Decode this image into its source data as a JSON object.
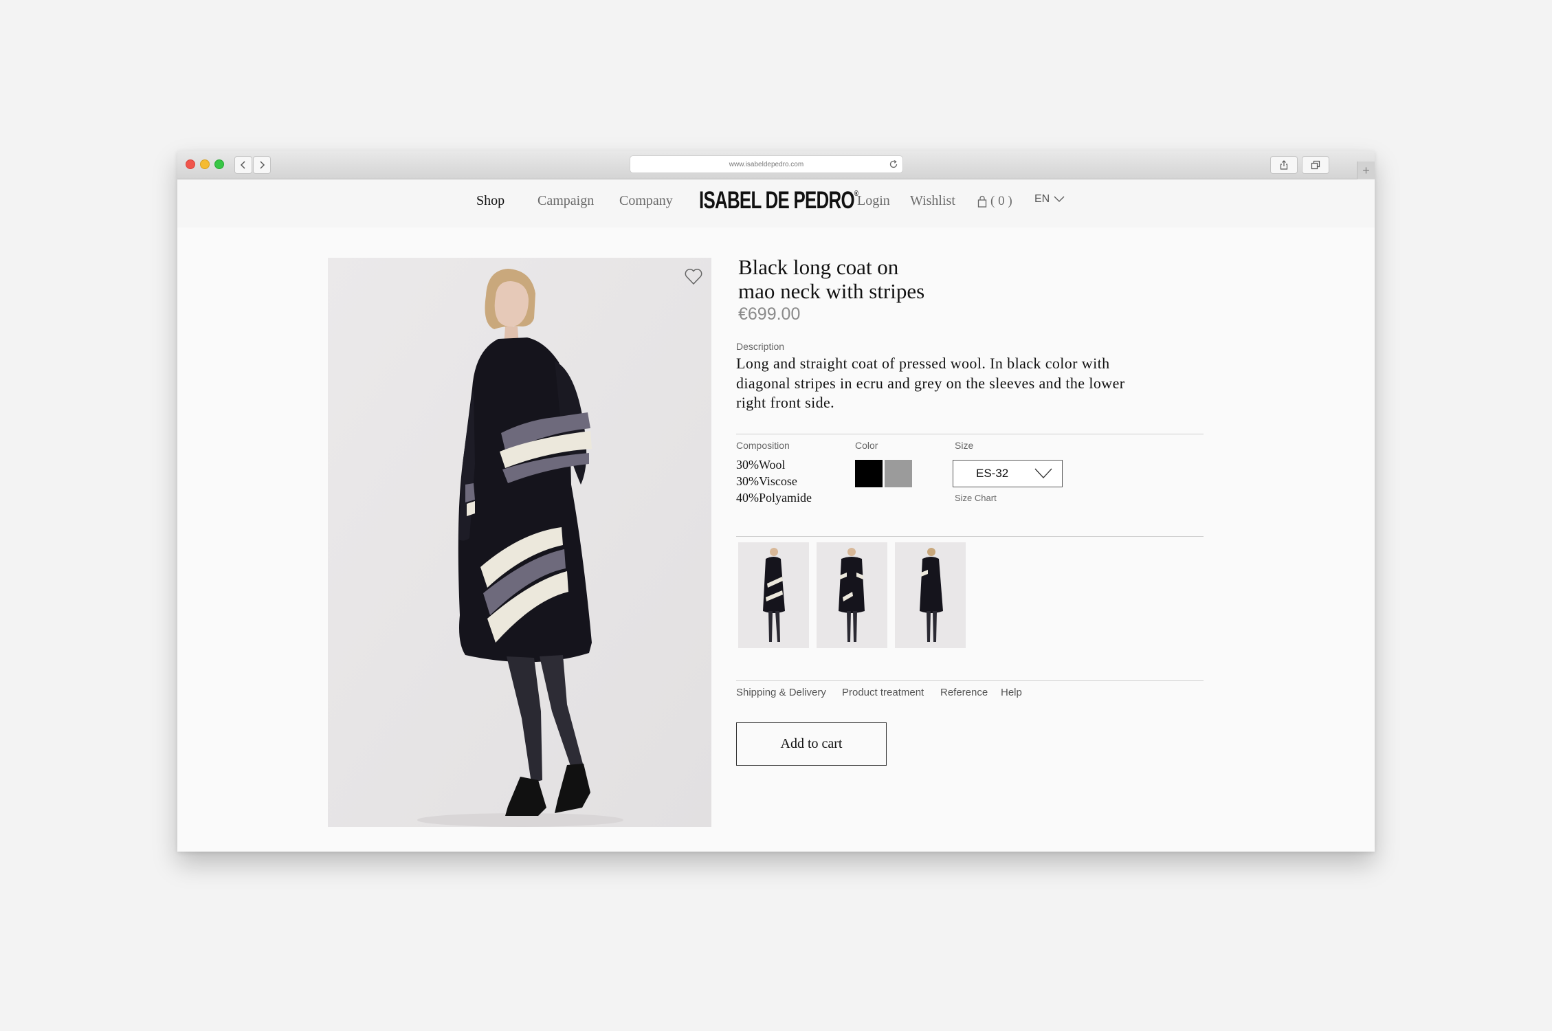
{
  "browser": {
    "url": "www.isabeldepedro.com"
  },
  "nav": {
    "shop": "Shop",
    "campaign": "Campaign",
    "company": "Company",
    "logo": "ISABEL DE PEDRO",
    "logo_mark": "®",
    "login": "Login",
    "wishlist": "Wishlist",
    "cart": "( 0 )",
    "language": "EN"
  },
  "product": {
    "title_line1": "Black long coat on",
    "title_line2": "mao neck with stripes",
    "price": "€699.00",
    "description_label": "Description",
    "description": "Long and straight coat of pressed wool. In black color with diagonal stripes in ecru and grey on the sleeves and the lower right front side.",
    "composition_label": "Composition",
    "composition": [
      "30%Wool",
      "30%Viscose",
      "40%Polyamide"
    ],
    "color_label": "Color",
    "colors": [
      "#000000",
      "#9b9b9b"
    ],
    "size_label": "Size",
    "size_value": "ES-32",
    "size_chart": "Size Chart",
    "add_to_cart": "Add to cart"
  },
  "info_links": [
    "Shipping & Delivery",
    "Product treatment",
    "Reference",
    "Help"
  ]
}
